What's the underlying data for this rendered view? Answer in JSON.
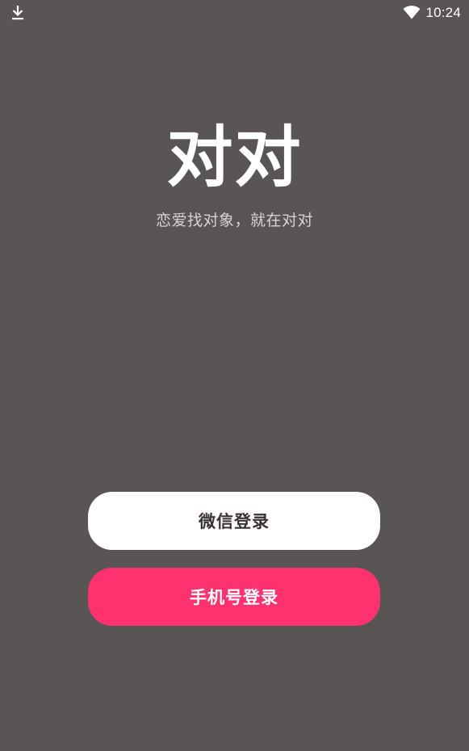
{
  "status_bar": {
    "time": "10:24",
    "left_icon": "download-icon",
    "right_icon": "wifi-icon"
  },
  "app": {
    "title": "对对",
    "tagline": "恋爱找对象，就在对对"
  },
  "buttons": {
    "wechat_login": "微信登录",
    "phone_login": "手机号登录"
  },
  "colors": {
    "background": "#5a5555",
    "primary_button": "#ff3270",
    "secondary_button": "#ffffff",
    "secondary_button_text": "#3a3032"
  }
}
